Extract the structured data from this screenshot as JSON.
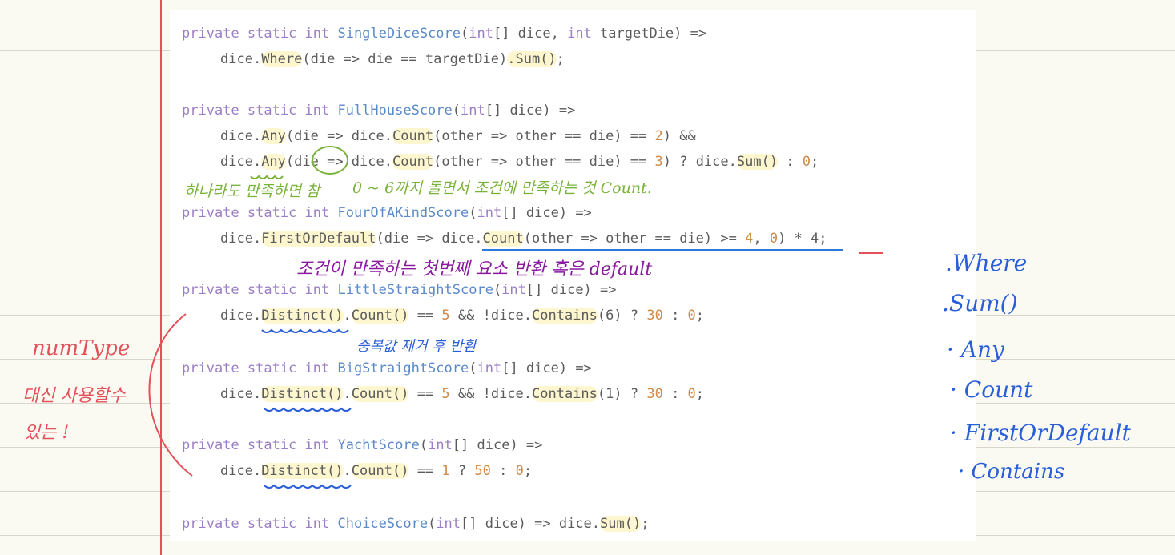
{
  "code": {
    "line1": {
      "kw": "private static int ",
      "fn": "SingleDiceScore",
      "p1": "(",
      "p2": "int",
      "p3": "[] dice, ",
      "p4": "int",
      "p5": " targetDie) =>"
    },
    "line2": {
      "a": "dice.",
      "b": "Where",
      "c": "(die => die == targetDie)",
      "d": ".Sum()",
      "e": ";"
    },
    "line3": {
      "kw": "private static int ",
      "fn": "FullHouseScore",
      "p1": "(",
      "p2": "int",
      "p3": "[] dice) =>"
    },
    "line4": {
      "a": "dice.",
      "b": "Any",
      "c": "(die => dice.",
      "d": "Count",
      "e": "(other => other == die) == ",
      "n": "2",
      "f": ") &&"
    },
    "line5": {
      "a": "dice.",
      "b": "Any",
      "c": "(die => dice.",
      "d": "Count",
      "e": "(other => other == die) == ",
      "n": "3",
      "f": ") ? dice.",
      "g": "Sum()",
      "h": " : ",
      "n2": "0",
      "i": ";"
    },
    "line6": {
      "kw": "private static int ",
      "fn": "FourOfAKindScore",
      "p1": "(",
      "p2": "int",
      "p3": "[] dice) =>"
    },
    "line7": {
      "a": "dice.",
      "b": "FirstOrDefault",
      "c": "(die => dice.",
      "d": "Count",
      "e": "(other => other == die) >= ",
      "n": "4",
      "f": ", ",
      "n2": "0",
      "g": ") * 4;"
    },
    "line8": {
      "kw": "private static int ",
      "fn": "LittleStraightScore",
      "p1": "(",
      "p2": "int",
      "p3": "[] dice) =>"
    },
    "line9": {
      "a": "dice.",
      "b": "Distinct()",
      "c": ".",
      "d": "Count()",
      "e": " == ",
      "n": "5",
      "f": " && !dice.",
      "g": "Contains",
      "h": "(6)",
      "i": " ? ",
      "n2": "30",
      "j": " : ",
      "n3": "0",
      "k": ";"
    },
    "line10": {
      "kw": "private static int ",
      "fn": "BigStraightScore",
      "p1": "(",
      "p2": "int",
      "p3": "[] dice) =>"
    },
    "line11": {
      "a": "dice.",
      "b": "Distinct()",
      "c": ".",
      "d": "Count()",
      "e": " == ",
      "n": "5",
      "f": " && !dice.",
      "g": "Contains",
      "h": "(1)",
      "i": " ? ",
      "n2": "30",
      "j": " : ",
      "n3": "0",
      "k": ";"
    },
    "line12": {
      "kw": "private static int ",
      "fn": "YachtScore",
      "p1": "(",
      "p2": "int",
      "p3": "[] dice) =>"
    },
    "line13": {
      "a": "dice.",
      "b": "Distinct()",
      "c": ".",
      "d": "Count()",
      "e": " == ",
      "n": "1",
      "f": " ? ",
      "n2": "50",
      "g": " : ",
      "n3": "0",
      "h": ";"
    },
    "line14": {
      "kw": "private static int ",
      "fn": "ChoiceScore",
      "p1": "(",
      "p2": "int",
      "p3": "[] dice) => dice.",
      "p4": "Sum()",
      "p5": ";"
    }
  },
  "annotations": {
    "any_note": "하나라도 만족하면 참",
    "count_note": "0 ~ 6까지 돌면서 조건에 만족하는 것 Count.",
    "first_note": "조건이 만족하는 첫번째 요소 반환 혹은 default",
    "distinct_note": "중복값 제거 후 반환",
    "side_num": "numType",
    "side_instead": "대신 사용할수",
    "side_exist": "있는 !",
    "list": [
      ".Where",
      ".Sum()",
      "· Any",
      "· Count",
      "· FirstOrDefault",
      "· Contains"
    ]
  },
  "colors": {
    "margin": "#e4515b",
    "green": "#7ab33a",
    "purple": "#8a1aa0",
    "blue": "#2a5fd8",
    "red": "#e4515b",
    "highlight": "#fdf6cf"
  }
}
